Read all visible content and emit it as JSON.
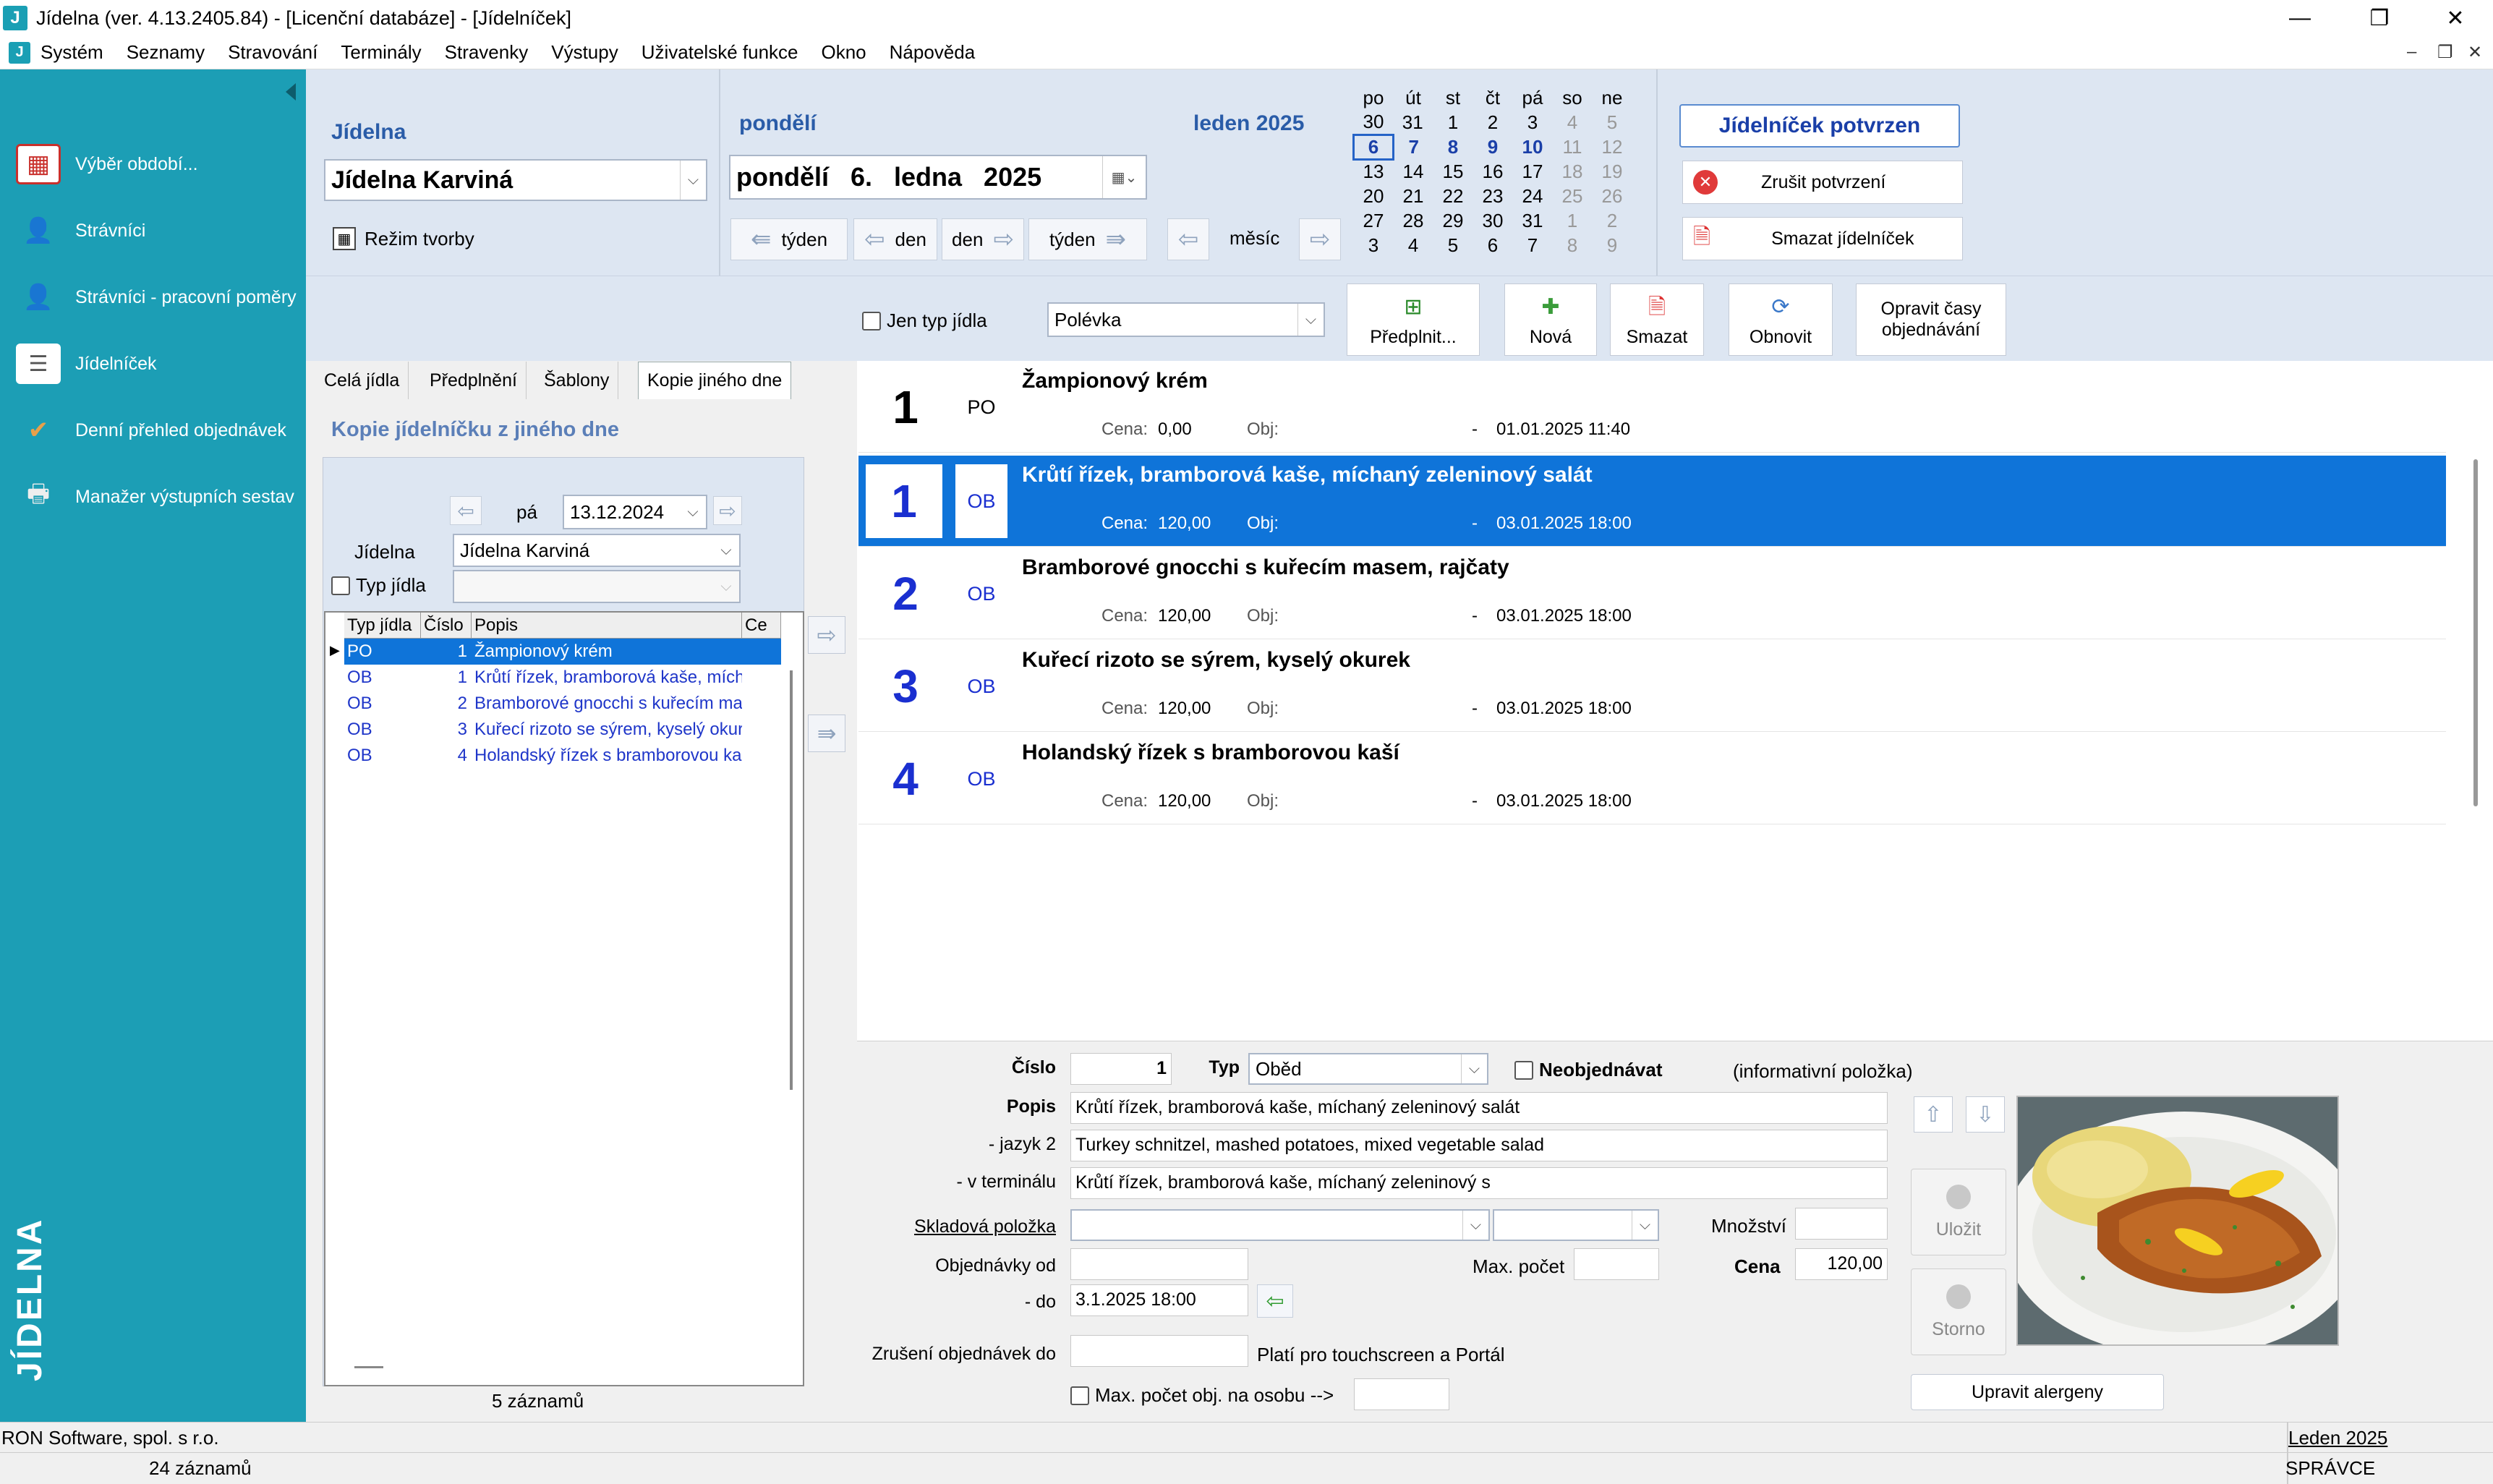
{
  "window": {
    "title": "Jídelna (ver. 4.13.2405.84) - [Licenční databáze] - [Jídelníček]",
    "app_icon": "J",
    "minimize": "—",
    "restore": "❐",
    "close": "✕"
  },
  "menu": [
    "Systém",
    "Seznamy",
    "Stravování",
    "Terminály",
    "Stravenky",
    "Výstupy",
    "Uživatelské funkce",
    "Okno",
    "Nápověda"
  ],
  "sidebar": {
    "items": [
      {
        "label": "Výběr období...",
        "icon": "calendar-icon"
      },
      {
        "label": "Strávníci",
        "icon": "person-icon"
      },
      {
        "label": "Strávníci - pracovní poměry",
        "icon": "person-work-icon"
      },
      {
        "label": "Jídelníček",
        "icon": "menu-list-icon"
      },
      {
        "label": "Denní přehled objednávek",
        "icon": "orders-icon"
      },
      {
        "label": "Manažer výstupních sestav",
        "icon": "printer-icon"
      }
    ],
    "logo": "JÍDELNA"
  },
  "header": {
    "jidelna_label": "Jídelna",
    "jidelna_value": "Jídelna Karviná",
    "rezim_label": "Režim tvorby",
    "day_label": "pondělí",
    "date_value": "pondělí   6.   ledna   2025",
    "month_label": "leden 2025",
    "nav": {
      "week_back": "týden",
      "day_back": "den",
      "day_fwd": "den",
      "week_fwd": "týden",
      "month": "měsíc"
    },
    "calendar": {
      "days": [
        "po",
        "út",
        "st",
        "čt",
        "pá",
        "so",
        "ne"
      ],
      "weeks": [
        [
          "30",
          "31",
          "1",
          "2",
          "3",
          "4",
          "5"
        ],
        [
          "6",
          "7",
          "8",
          "9",
          "10",
          "11",
          "12"
        ],
        [
          "13",
          "14",
          "15",
          "16",
          "17",
          "18",
          "19"
        ],
        [
          "20",
          "21",
          "22",
          "23",
          "24",
          "25",
          "26"
        ],
        [
          "27",
          "28",
          "29",
          "30",
          "31",
          "1",
          "2"
        ],
        [
          "3",
          "4",
          "5",
          "6",
          "7",
          "8",
          "9"
        ]
      ]
    },
    "confirmed_btn": "Jídelníček potvrzen",
    "cancel_confirm_btn": "Zrušit potvrzení",
    "delete_menu_btn": "Smazat jídelníček"
  },
  "toolbar": {
    "only_type_label": "Jen typ jídla",
    "type_value": "Polévka",
    "prefill": "Předplnit...",
    "new": "Nová",
    "delete": "Smazat",
    "refresh": "Obnovit",
    "fix_times": "Opravit časy objednávání"
  },
  "left_panel": {
    "tabs": [
      "Celá jídla",
      "Předplnění",
      "Šablony",
      "Kopie jiného dne"
    ],
    "title": "Kopie jídelníčku z jiného dne",
    "day_abbr": "pá",
    "date": "13.12.2024",
    "jidelna_label": "Jídelna",
    "jidelna_value": "Jídelna Karviná",
    "typ_label": "Typ jídla",
    "columns": [
      "Typ jídla",
      "Číslo",
      "Popis",
      "Ce"
    ],
    "rows": [
      {
        "typ": "PO",
        "cislo": "1",
        "popis": "Žampionový krém"
      },
      {
        "typ": "OB",
        "cislo": "1",
        "popis": "Krůtí řízek, bramborová kaše, míchaný zeleninový salát"
      },
      {
        "typ": "OB",
        "cislo": "2",
        "popis": "Bramborové gnocchi s kuřecím masem, rajčaty"
      },
      {
        "typ": "OB",
        "cislo": "3",
        "popis": "Kuřecí rizoto se sýrem, kyselý okurek"
      },
      {
        "typ": "OB",
        "cislo": "4",
        "popis": "Holandský řízek s bramborovou kaší"
      }
    ],
    "count": "5 záznamů"
  },
  "menu_items": [
    {
      "num": "1",
      "typ": "PO",
      "name": "Žampionový krém",
      "cena_label": "Cena:",
      "cena": "0,00",
      "obj_label": "Obj:",
      "dash": "-",
      "datetime": "01.01.2025 11:40"
    },
    {
      "num": "1",
      "typ": "OB",
      "name": "Krůtí řízek, bramborová kaše, míchaný zeleninový salát",
      "cena_label": "Cena:",
      "cena": "120,00",
      "obj_label": "Obj:",
      "dash": "-",
      "datetime": "03.01.2025 18:00"
    },
    {
      "num": "2",
      "typ": "OB",
      "name": "Bramborové gnocchi s kuřecím masem, rajčaty",
      "cena_label": "Cena:",
      "cena": "120,00",
      "obj_label": "Obj:",
      "dash": "-",
      "datetime": "03.01.2025 18:00"
    },
    {
      "num": "3",
      "typ": "OB",
      "name": "Kuřecí rizoto se sýrem, kyselý okurek",
      "cena_label": "Cena:",
      "cena": "120,00",
      "obj_label": "Obj:",
      "dash": "-",
      "datetime": "03.01.2025 18:00"
    },
    {
      "num": "4",
      "typ": "OB",
      "name": "Holandský řízek s bramborovou kaší",
      "cena_label": "Cena:",
      "cena": "120,00",
      "obj_label": "Obj:",
      "dash": "-",
      "datetime": "03.01.2025 18:00"
    }
  ],
  "detail": {
    "cislo_label": "Číslo",
    "cislo_value": "1",
    "typ_label": "Typ",
    "typ_value": "Oběd",
    "neobjednavat_label": "Neobjednávat",
    "info_label": "(informativní položka)",
    "popis_label": "Popis",
    "popis_value": "Krůtí řízek, bramborová kaše, míchaný zeleninový salát",
    "jazyk2_label": "- jazyk 2",
    "jazyk2_value": "Turkey schnitzel, mashed potatoes, mixed vegetable salad",
    "terminal_label": "- v terminálu",
    "terminal_value": "Krůtí řízek, bramborová kaše, míchaný zeleninový s",
    "sklad_label": "Skladová položka",
    "mnozstvi_label": "Množství",
    "obj_od_label": "Objednávky od",
    "max_pocet_label": "Max. počet",
    "cena_label": "Cena",
    "cena_value": "120,00",
    "do_label": "- do",
    "do_value": "3.1.2025 18:00",
    "zruseni_label": "Zrušení objednávek do",
    "plati_label": "Platí pro touchscreen a Portál",
    "max_osoba_label": "Max. počet obj. na osobu -->",
    "save": "Uložit",
    "storno": "Storno",
    "alergeny": "Upravit alergeny"
  },
  "status": {
    "company": "RON Software, spol. s r.o.",
    "records": "24 záznamů",
    "period": "Leden 2025",
    "user": "SPRÁVCE"
  }
}
